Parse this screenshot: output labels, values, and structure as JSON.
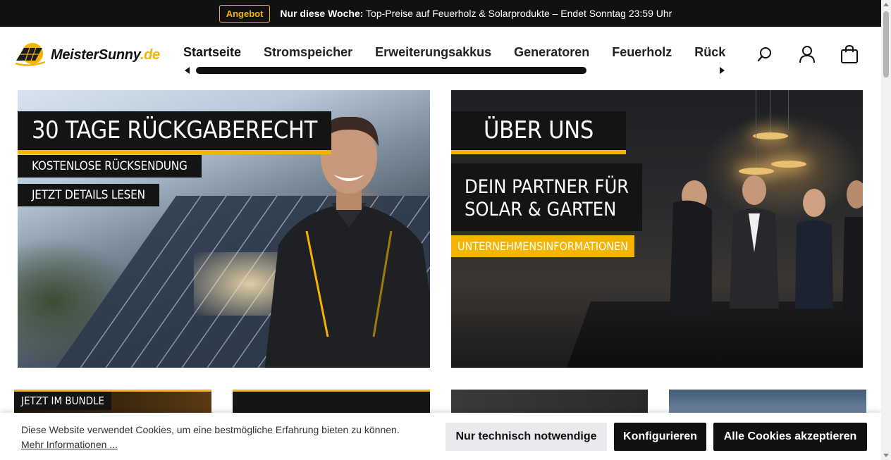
{
  "topbar": {
    "badge": "Angebot",
    "promo_bold": "Nur diese Woche:",
    "promo_text": " Top-Preise auf Feuerholz & Solarprodukte – Endet Sonntag 23:59 Uhr"
  },
  "logo": {
    "name": "MeisterSunny",
    "tld": ".de"
  },
  "nav": {
    "items": [
      "Startseite",
      "Stromspeicher",
      "Erweiterungsakkus",
      "Generatoren",
      "Feuerholz",
      "Rückgaberecht"
    ]
  },
  "header_icons": [
    "search-icon",
    "user-icon",
    "cart-icon"
  ],
  "banners": {
    "left": {
      "title": "30 TAGE RÜCKGABERECHT",
      "sub1": "KOSTENLOSE RÜCKSENDUNG",
      "sub2": "JETZT DETAILS LESEN"
    },
    "right": {
      "title": "ÜBER UNS",
      "line1": "DEIN PARTNER FÜR",
      "line2": "SOLAR & GARTEN",
      "cta": "UNTERNEHMENSINFORMATIONEN"
    }
  },
  "cards": {
    "first_tag": "JETZT IM BUNDLE"
  },
  "cookie": {
    "text": "Diese Website verwendet Cookies, um eine bestmögliche Erfahrung bieten zu können. ",
    "link": "Mehr Informationen ...",
    "btn_necessary": "Nur technisch notwendige",
    "btn_configure": "Konfigurieren",
    "btn_accept": "Alle Cookies akzeptieren"
  },
  "colors": {
    "accent": "#f4b400",
    "dark": "#111111"
  }
}
